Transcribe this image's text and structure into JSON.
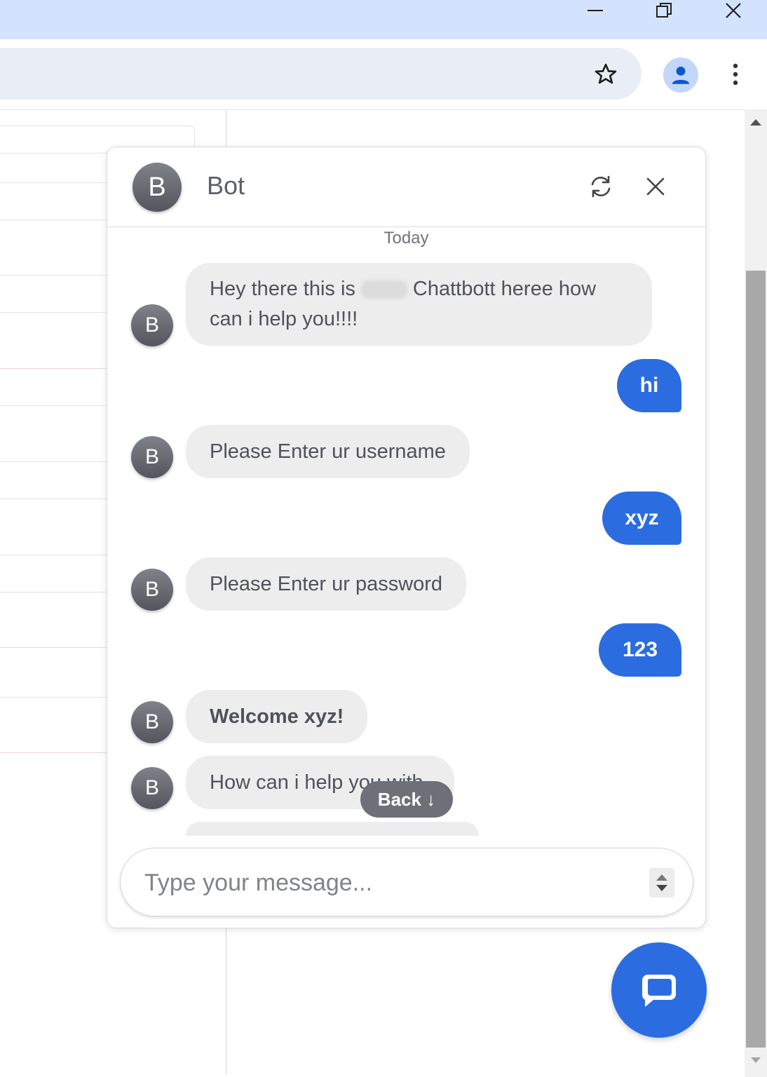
{
  "colors": {
    "accent": "#2b6de0",
    "bot_bubble": "#ededee",
    "titlebar": "#d3e3fd"
  },
  "browser": {
    "window_controls": [
      "minimize-icon",
      "restore-icon",
      "close-icon"
    ],
    "toolbar_icons": [
      "star-icon",
      "profile-icon",
      "more-vert-icon"
    ]
  },
  "chat": {
    "header": {
      "avatar_letter": "B",
      "title": "Bot",
      "icons": [
        "refresh-icon",
        "close-icon"
      ]
    },
    "date_label": "Today",
    "messages": [
      {
        "sender": "bot",
        "avatar": "B",
        "text_before": "Hey there this is",
        "text_after": "Chattbott heree how can i help you!!!!"
      },
      {
        "sender": "user",
        "text": "hi"
      },
      {
        "sender": "bot",
        "avatar": "B",
        "text": "Please Enter ur username"
      },
      {
        "sender": "user",
        "text": "xyz"
      },
      {
        "sender": "bot",
        "avatar": "B",
        "text": "Please Enter ur password"
      },
      {
        "sender": "user",
        "text": "123"
      },
      {
        "sender": "bot",
        "avatar": "B",
        "text": "Welcome xyz!"
      },
      {
        "sender": "bot",
        "avatar": "B",
        "text": "How can i help you with"
      }
    ],
    "back_button": "Back ↓",
    "input": {
      "placeholder": "Type your message...",
      "value": ""
    },
    "launcher_icon": "chat-bubble-icon"
  }
}
